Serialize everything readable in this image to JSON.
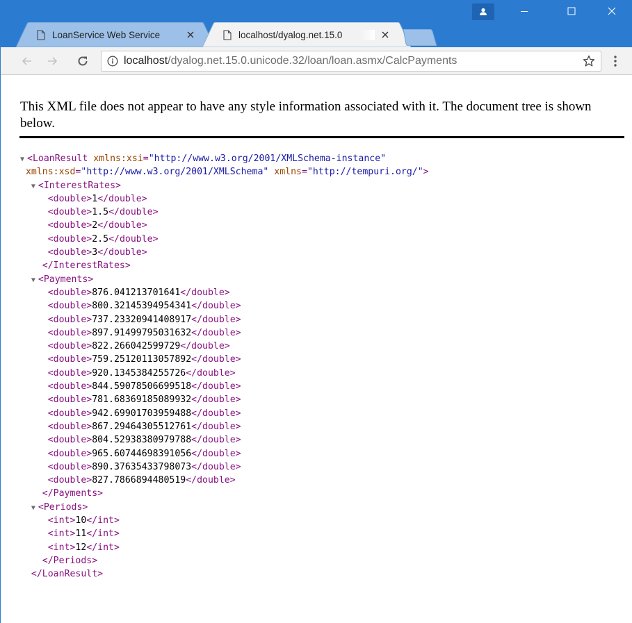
{
  "tabs": [
    {
      "title": "LoanService Web Service",
      "active": false
    },
    {
      "title": "localhost/dyalog.net.15.0",
      "active": true
    }
  ],
  "address_bar": {
    "host": "localhost",
    "path": "/dyalog.net.15.0.unicode.32/loan/loan.asmx/CalcPayments"
  },
  "info_text": "This XML file does not appear to have any style information associated with it. The document tree is shown below.",
  "xml": {
    "root_tag": "LoanResult",
    "root_attrs_line1": [
      {
        "name": "xmlns:xsi",
        "value": "\"http://www.w3.org/2001/XMLSchema-instance\""
      }
    ],
    "root_attrs_line2": [
      {
        "name": "xmlns:xsd",
        "value": "\"http://www.w3.org/2001/XMLSchema\""
      },
      {
        "name": "xmlns",
        "value": "\"http://tempuri.org/\""
      }
    ],
    "sections": [
      {
        "tag": "InterestRates",
        "child_tag": "double",
        "values": [
          "1",
          "1.5",
          "2",
          "2.5",
          "3"
        ]
      },
      {
        "tag": "Payments",
        "child_tag": "double",
        "values": [
          "876.041213701641",
          "800.32145394954341",
          "737.23320941408917",
          "897.91499795031632",
          "822.266042599729",
          "759.25120113057892",
          "920.1345384255726",
          "844.59078506699518",
          "781.68369185089932",
          "942.69901703959488",
          "867.29464305512761",
          "804.52938380979788",
          "965.60744698391056",
          "890.37635433798073",
          "827.7866894480519"
        ]
      },
      {
        "tag": "Periods",
        "child_tag": "int",
        "values": [
          "10",
          "11",
          "12"
        ]
      }
    ]
  },
  "colors": {
    "titlebar": "#2b7bd1",
    "tag": "#881280",
    "attribute_name": "#994500",
    "attribute_value": "#1a1aa6"
  },
  "icons": [
    "document-icon",
    "close-icon",
    "back-icon",
    "forward-icon",
    "reload-icon",
    "info-icon",
    "star-icon",
    "menu-icon",
    "profile-icon",
    "minimize-icon",
    "maximize-icon",
    "window-close-icon",
    "collapse-triangle-icon"
  ]
}
